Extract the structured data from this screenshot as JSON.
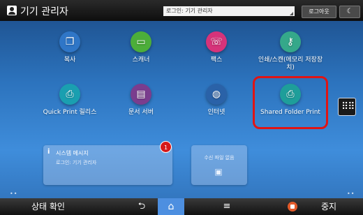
{
  "header": {
    "user_icon": "user-icon",
    "title": "기기 관리자",
    "login_status": "로그인: 기기 관리자",
    "logout_label": "로그아웃",
    "brightness_icon": "crescent-moon-icon"
  },
  "apps": [
    {
      "label": "복사",
      "icon": "copy-icon",
      "color": "#2f76c7"
    },
    {
      "label": "스캐너",
      "icon": "scanner-icon",
      "color": "#4cae3a"
    },
    {
      "label": "팩스",
      "icon": "fax-icon",
      "color": "#d6337a"
    },
    {
      "label": "인쇄/스캔(메모리 저장장치)",
      "icon": "usb-memory-icon",
      "color": "#35a88a"
    },
    {
      "label": "Quick Print 릴리스",
      "icon": "quick-print-icon",
      "color": "#1a9fb0"
    },
    {
      "label": "문서 서버",
      "icon": "document-server-icon",
      "color": "#7a3d8e"
    },
    {
      "label": "인터넷",
      "icon": "globe-icon",
      "color": "#2a62a8"
    },
    {
      "label": "Shared Folder Print",
      "icon": "shared-folder-print-icon",
      "color": "#1e9e9a"
    }
  ],
  "widgets": {
    "system_message": {
      "title": "시스템 메시지",
      "text": "로그인: 기기 관리자",
      "badge": "1",
      "icon": "info-icon"
    },
    "received_fax": {
      "label": "수신 파일 없음",
      "icon": "fax-document-icon"
    }
  },
  "app_list_icon": "grid-icon",
  "page_dots": {
    "left": "••",
    "right": "••"
  },
  "footer": {
    "status_label": "상태 확인",
    "back_icon": "back-arrow-icon",
    "home_icon": "home-icon",
    "menu_icon": "menu-icon",
    "stop_label": "중지",
    "stop_icon": "stop-icon"
  },
  "colors": {
    "accent": "#4d8fe0",
    "highlight": "#e01414",
    "badge": "#d61a1a"
  }
}
